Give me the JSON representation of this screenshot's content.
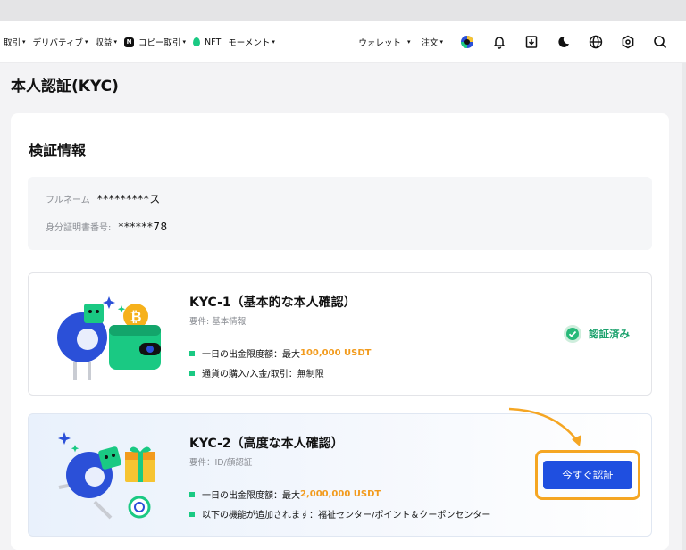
{
  "nav": {
    "items": [
      {
        "label": "取引",
        "caret": "▾"
      },
      {
        "label": "デリバティブ",
        "caret": "▾"
      },
      {
        "label": "収益",
        "caret": "▾"
      },
      {
        "label": "コピー取引",
        "caret": "▾",
        "badge": "N"
      },
      {
        "label": "NFT"
      },
      {
        "label": "モーメント",
        "caret": "▾"
      }
    ],
    "wallet": "ウォレット",
    "orders": "注文",
    "caret": "▾"
  },
  "page_title": "本人認証(KYC)",
  "section_title": "検証情報",
  "info": {
    "name_label": "フルネーム",
    "name_value": "*********ス",
    "id_label": "身分証明書番号:",
    "id_value": "******78"
  },
  "kyc1": {
    "title": "KYC-1（基本的な本人確認）",
    "requirement": "要件: 基本情報",
    "bullet1_prefix": "一日の出金限度額：最大",
    "bullet1_amount": "100,000 USDT",
    "bullet2": "通貨の購入/入金/取引：無制限",
    "status": "認証済み"
  },
  "kyc2": {
    "title": "KYC-2（高度な本人確認）",
    "requirement": "要件：ID/顔認証",
    "bullet1_prefix": "一日の出金限度額：最大",
    "bullet1_amount": "2,000,000 USDT",
    "bullet2": "以下の機能が追加されます：福祉センター/ポイント＆クーポンセンター",
    "button": "今すぐ認証"
  },
  "colors": {
    "accent_green": "#1ac983",
    "amount_orange": "#f29b1d",
    "button_blue": "#1f4fe0",
    "highlight_orange": "#f5a623"
  }
}
